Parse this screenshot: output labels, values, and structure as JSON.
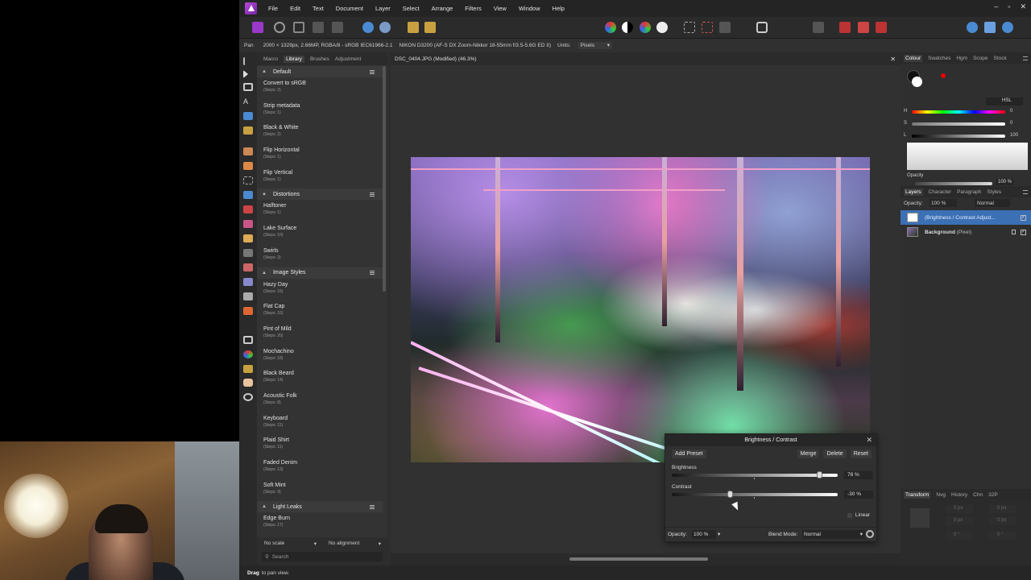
{
  "menubar": {
    "items": [
      "File",
      "Edit",
      "Text",
      "Document",
      "Layer",
      "Select",
      "Arrange",
      "Filters",
      "View",
      "Window",
      "Help"
    ]
  },
  "context": {
    "tool": "Pan",
    "image_info": "2000 × 1329px, 2.66MP, RGBA/8 - sRGB IEC61966-2.1",
    "camera": "NIKON D3200 (AF-S DX Zoom-Nikkor 18-55mm f/3.5-5.6G ED II)",
    "units_label": "Units:",
    "units_value": "Pixels"
  },
  "assets": {
    "tabs": [
      "Macro",
      "Library",
      "Brushes",
      "Adjustment"
    ],
    "active_tab": "Library",
    "categories": [
      {
        "name": "Default",
        "presets": [
          {
            "name": "Convert to sRGB",
            "steps": "(Steps: 2)"
          },
          {
            "name": "Strip metadata",
            "steps": "(Steps: 1)"
          },
          {
            "name": "Black & White",
            "steps": "(Steps: 2)"
          },
          {
            "name": "Flip Horizontal",
            "steps": "(Steps: 1)"
          },
          {
            "name": "Flip Vertical",
            "steps": "(Steps: 1)"
          }
        ]
      },
      {
        "name": "Distortions",
        "presets": [
          {
            "name": "Halftoner",
            "steps": "(Steps: 1)"
          },
          {
            "name": "Lake Surface",
            "steps": "(Steps: 10)"
          },
          {
            "name": "Swirls",
            "steps": "(Steps: 3)"
          }
        ]
      },
      {
        "name": "Image Styles",
        "presets": [
          {
            "name": "Hazy Day",
            "steps": "(Steps: 16)"
          },
          {
            "name": "Flat Cap",
            "steps": "(Steps: 10)"
          },
          {
            "name": "Pint of Mild",
            "steps": "(Steps: 20)"
          },
          {
            "name": "Mochachino",
            "steps": "(Steps: 18)"
          },
          {
            "name": "Black Beard",
            "steps": "(Steps: 14)"
          },
          {
            "name": "Acoustic Folk",
            "steps": "(Steps: 8)"
          },
          {
            "name": "Keyboard",
            "steps": "(Steps: 11)"
          },
          {
            "name": "Plaid Shirt",
            "steps": "(Steps: 11)"
          },
          {
            "name": "Faded Denim",
            "steps": "(Steps: 13)"
          },
          {
            "name": "Soft Mint",
            "steps": "(Steps: 9)"
          }
        ]
      },
      {
        "name": "Light Leaks",
        "presets": [
          {
            "name": "Edge Burn",
            "steps": "(Steps: 17)"
          }
        ]
      }
    ],
    "scale_value": "No scale",
    "align_value": "No alignment",
    "search_placeholder": "Search"
  },
  "document": {
    "tab_title": "DSC_0404.JPG (Modified) (46.3%)"
  },
  "brightness_contrast": {
    "title": "Brightness / Contrast",
    "add_preset": "Add Preset",
    "merge": "Merge",
    "delete": "Delete",
    "reset": "Reset",
    "brightness_label": "Brightness",
    "brightness_value": "78 %",
    "brightness_level": 0.89,
    "contrast_label": "Contrast",
    "contrast_value": "-30 %",
    "contrast_level": 0.35,
    "linear_label": "Linear",
    "opacity_label": "Opacity:",
    "opacity_value": "100 %",
    "blend_label": "Blend Mode:",
    "blend_value": "Normal"
  },
  "colour_panel": {
    "tabs": [
      "Colour",
      "Swatches",
      "Hgm",
      "Scope",
      "Stock"
    ],
    "active_tab": "Colour",
    "model": "HSL",
    "h_label": "H",
    "h_value": "0",
    "s_label": "S",
    "s_value": "0",
    "l_label": "L",
    "l_value": "100",
    "opacity_label": "Opacity",
    "opacity_value": "100 %"
  },
  "layers_panel": {
    "tabs": [
      "Layers",
      "Character",
      "Paragraph",
      "Styles"
    ],
    "active_tab": "Layers",
    "opacity_label": "Opacity:",
    "opacity_value": "100 %",
    "blend_value": "Normal",
    "layers": [
      {
        "name": "(Brightness / Contrast Adjust...",
        "sub": ""
      },
      {
        "name": "Background",
        "sub": "(Pixel)"
      }
    ]
  },
  "lower_panel": {
    "tabs": [
      "Transform",
      "Nvg",
      "History",
      "Chn",
      "32P"
    ],
    "active_tab": "Transform",
    "fields": [
      "0 px",
      "0 px",
      "0 px",
      "0 px",
      "0 °",
      "0 °"
    ]
  },
  "status": {
    "action": "Drag",
    "hint": "to pan view."
  },
  "colors": {
    "accent": "#3c70b5",
    "brand": "#9a39c8"
  }
}
